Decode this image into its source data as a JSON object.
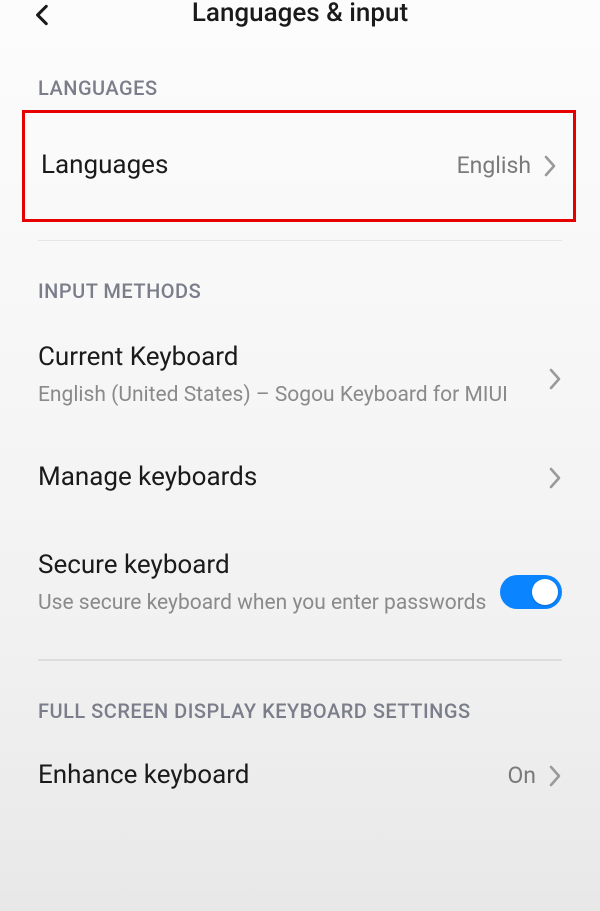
{
  "header": {
    "title": "Languages & input"
  },
  "sections": {
    "languages": {
      "header": "LANGUAGES",
      "row": {
        "title": "Languages",
        "value": "English"
      }
    },
    "inputMethods": {
      "header": "INPUT METHODS",
      "currentKeyboard": {
        "title": "Current Keyboard",
        "subtitle": "English (United States) – Sogou Keyboard for MIUI"
      },
      "manageKeyboards": {
        "title": "Manage keyboards"
      },
      "secureKeyboard": {
        "title": "Secure keyboard",
        "subtitle": "Use secure keyboard when you enter passwords",
        "enabled": true
      }
    },
    "fullScreen": {
      "header": "FULL SCREEN DISPLAY KEYBOARD SETTINGS",
      "enhanceKeyboard": {
        "title": "Enhance keyboard",
        "value": "On"
      }
    }
  }
}
